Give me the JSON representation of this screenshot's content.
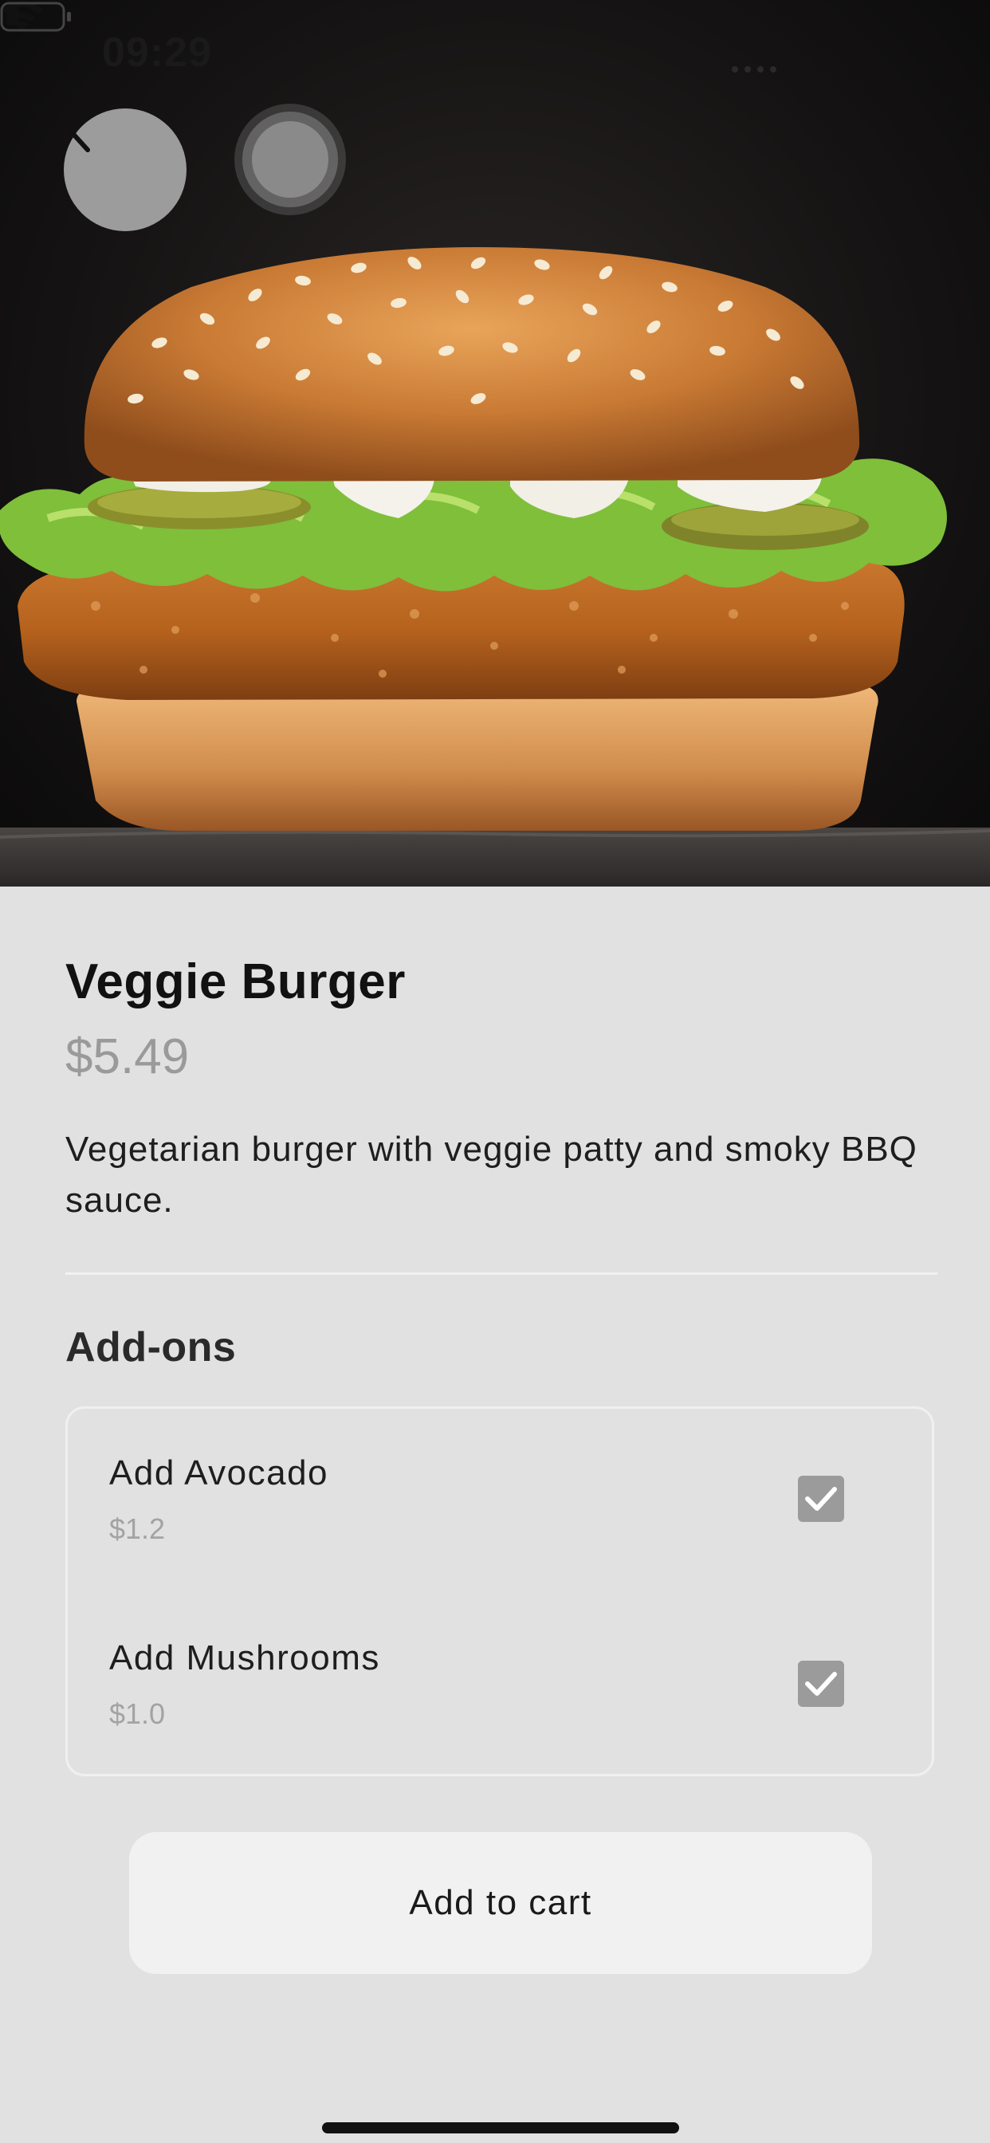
{
  "status_bar": {
    "time": "09:29"
  },
  "icons": {
    "back": "chevron-left-icon",
    "record": "record-icon",
    "wifi": "wifi-icon",
    "battery": "battery-icon",
    "check": "check-icon"
  },
  "hero": {
    "image_subject": "veggie burger photo"
  },
  "product": {
    "title": "Veggie Burger",
    "price": "$5.49",
    "description": "Vegetarian burger with veggie patty and smoky BBQ sauce."
  },
  "addons": {
    "heading": "Add-ons",
    "items": [
      {
        "name": "Add Avocado",
        "price": "$1.2",
        "checked": true
      },
      {
        "name": "Add Mushrooms",
        "price": "$1.0",
        "checked": true
      }
    ]
  },
  "actions": {
    "add_to_cart": "Add to cart"
  },
  "colors": {
    "background": "#e1e1e1",
    "checkbox": "#9b9b9b",
    "price_text": "#9a9a9a",
    "button_bg": "#f1f1f1"
  }
}
